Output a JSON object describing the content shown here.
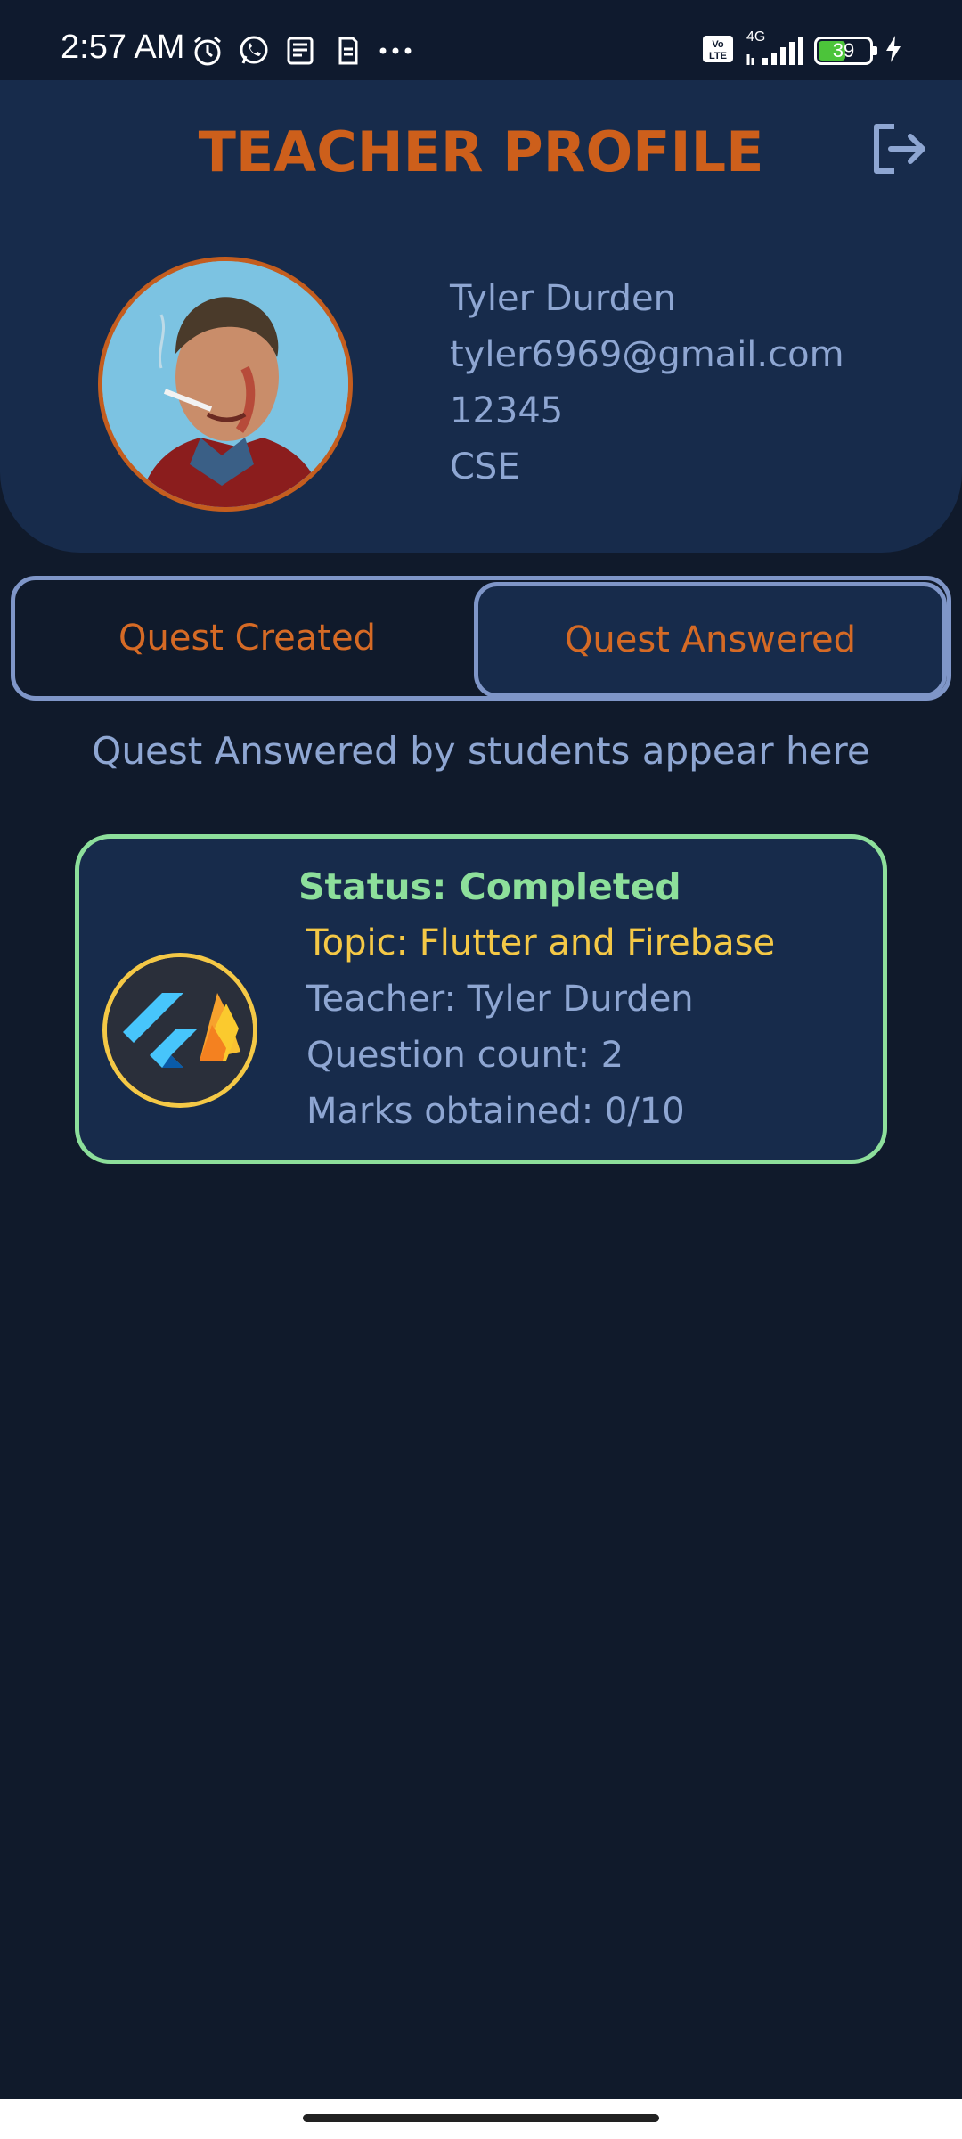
{
  "status_bar": {
    "time": "2:57 AM",
    "network": "4G",
    "battery": "39",
    "icons": [
      "alarm-icon",
      "whatsapp-icon",
      "news-icon",
      "sim-icon",
      "more-dots-icon",
      "volte-icon",
      "signal-icon",
      "battery-icon",
      "charging-icon"
    ]
  },
  "header": {
    "title": "TEACHER PROFILE",
    "logout_icon": "logout-icon"
  },
  "profile": {
    "name": "Tyler Durden",
    "email": "tyler6969@gmail.com",
    "id": "12345",
    "department": "CSE"
  },
  "tabs": [
    {
      "label": "Quest Created",
      "active": false
    },
    {
      "label": "Quest Answered",
      "active": true
    }
  ],
  "section_hint": "Quest Answered by students appear here",
  "quests": [
    {
      "status": "Status: Completed",
      "topic": "Topic: Flutter and Firebase",
      "teacher": "Teacher: Tyler Durden",
      "question_count": "Question count: 2",
      "marks": "Marks obtained: 0/10"
    }
  ],
  "colors": {
    "accent_orange": "#cd5f1b",
    "text_blue": "#8ea6d2",
    "status_green": "#8ddf9b",
    "topic_yellow": "#f4c846",
    "card_bg": "#172b4b",
    "page_bg": "#101a2b"
  }
}
